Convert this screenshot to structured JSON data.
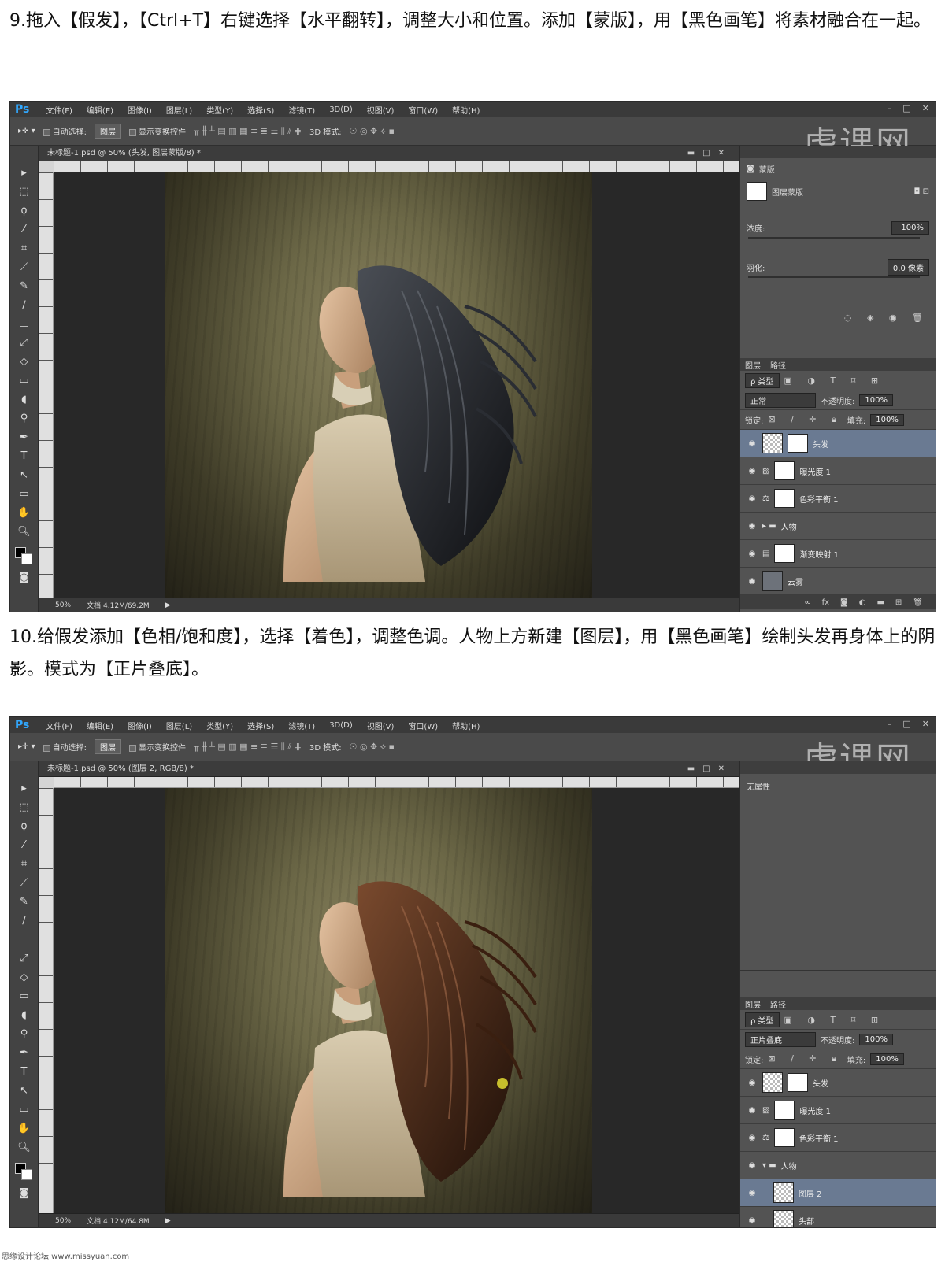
{
  "step9": {
    "caption": "9.拖入【假发】，【Ctrl+T】右键选择【水平翻转】，调整大小和位置。添加【蒙版】，用【黑色画笔】将素材融合在一起。"
  },
  "step10": {
    "caption": "10.给假发添加【色相/饱和度】，选择【着色】，调整色调。人物上方新建【图层】，用【黑色画笔】绘制头发再身体上的阴影。模式为【正片叠底】。"
  },
  "ps": {
    "logo": "Ps",
    "menus": [
      "文件(F)",
      "编辑(E)",
      "图像(I)",
      "图层(L)",
      "类型(Y)",
      "选择(S)",
      "滤镜(T)",
      "3D(D)",
      "视图(V)",
      "窗口(W)",
      "帮助(H)"
    ],
    "options": {
      "auto_select": "自动选择:",
      "auto_select_value": "图层",
      "show_transform": "显示变换控件",
      "mode3d": "3D 模式:"
    },
    "watermark": "虎课网",
    "zoom": "50%"
  },
  "shot1": {
    "doc_title": "未标题-1.psd @ 50% (头发, 图层蒙版/8) *",
    "doc_size": "文档:4.12M/69.2M",
    "props": {
      "title": "蒙版",
      "mask_label": "图层蒙版",
      "density_label": "浓度:",
      "density_value": "100%",
      "feather_label": "羽化:",
      "feather_value": "0.0 像素"
    },
    "layers_tabs": [
      "图层",
      "路径"
    ],
    "kind": "ρ 类型",
    "blend_mode": "正常",
    "opacity_label": "不透明度:",
    "opacity": "100%",
    "lock_label": "锁定:",
    "fill_label": "填充:",
    "fill": "100%",
    "layers": [
      {
        "name": "头发",
        "selected": true
      },
      {
        "name": "曝光度 1",
        "selected": false
      },
      {
        "name": "色彩平衡 1",
        "selected": false
      },
      {
        "name": "人物",
        "selected": false
      },
      {
        "name": "渐变映射 1",
        "selected": false
      },
      {
        "name": "云雾",
        "selected": false
      }
    ]
  },
  "shot2": {
    "doc_title": "未标题-1.psd @ 50% (图层 2, RGB/8) *",
    "doc_size": "文档:4.12M/64.8M",
    "props_title": "无属性",
    "layers_tabs": [
      "图层",
      "路径"
    ],
    "kind": "ρ 类型",
    "blend_mode": "正片叠底",
    "opacity_label": "不透明度:",
    "opacity": "100%",
    "lock_label": "锁定:",
    "fill_label": "填充:",
    "fill": "100%",
    "layers": [
      {
        "name": "头发",
        "selected": false
      },
      {
        "name": "曝光度 1",
        "selected": false
      },
      {
        "name": "色彩平衡 1",
        "selected": false
      },
      {
        "name": "人物",
        "selected": false
      },
      {
        "name": "图层 2",
        "selected": true
      },
      {
        "name": "头部",
        "selected": false
      }
    ]
  },
  "credit": "思缘设计论坛 www.missyuan.com"
}
